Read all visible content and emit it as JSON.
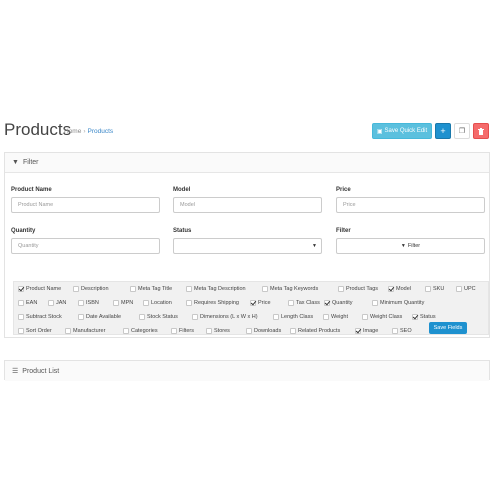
{
  "header": {
    "title": "Products",
    "breadcrumb": [
      "Home",
      "Products"
    ],
    "save_quick_edit": "Save Quick Edit",
    "add_icon": "plus-icon",
    "copy_icon": "copy-icon",
    "delete_icon": "trash-icon"
  },
  "filter": {
    "heading": "Filter",
    "product_name_label": "Product Name",
    "product_name_placeholder": "Product Name",
    "model_label": "Model",
    "model_placeholder": "Model",
    "price_label": "Price",
    "price_placeholder": "Price",
    "quantity_label": "Quantity",
    "quantity_placeholder": "Quantity",
    "status_label": "Status",
    "status_value": "",
    "filter_label": "Filter",
    "filter_button": "Filter"
  },
  "fields": {
    "items": [
      {
        "label": "Product Name",
        "checked": true
      },
      {
        "label": "Description",
        "checked": false
      },
      {
        "label": "Meta Tag Title",
        "checked": false
      },
      {
        "label": "Meta Tag Description",
        "checked": false
      },
      {
        "label": "Meta Tag Keywords",
        "checked": false
      },
      {
        "label": "Product Tags",
        "checked": false
      },
      {
        "label": "Model",
        "checked": true
      },
      {
        "label": "SKU",
        "checked": false
      },
      {
        "label": "UPC",
        "checked": false
      },
      {
        "label": "EAN",
        "checked": false
      },
      {
        "label": "JAN",
        "checked": false
      },
      {
        "label": "ISBN",
        "checked": false
      },
      {
        "label": "MPN",
        "checked": false
      },
      {
        "label": "Location",
        "checked": false
      },
      {
        "label": "Requires Shipping",
        "checked": false
      },
      {
        "label": "Price",
        "checked": true
      },
      {
        "label": "Tax Class",
        "checked": false
      },
      {
        "label": "Quantity",
        "checked": true
      },
      {
        "label": "Minimum Quantity",
        "checked": false
      },
      {
        "label": "Subtract Stock",
        "checked": false
      },
      {
        "label": "Date Available",
        "checked": false
      },
      {
        "label": "Stock Status",
        "checked": false
      },
      {
        "label": "Dimensions (L x W x H)",
        "checked": false
      },
      {
        "label": "Length Class",
        "checked": false
      },
      {
        "label": "Weight",
        "checked": false
      },
      {
        "label": "Weight Class",
        "checked": false
      },
      {
        "label": "Status",
        "checked": true
      },
      {
        "label": "Sort Order",
        "checked": false
      },
      {
        "label": "Manufacturer",
        "checked": false
      },
      {
        "label": "Categories",
        "checked": false
      },
      {
        "label": "Filters",
        "checked": false
      },
      {
        "label": "Stores",
        "checked": false
      },
      {
        "label": "Downloads",
        "checked": false
      },
      {
        "label": "Related Products",
        "checked": false
      },
      {
        "label": "Image",
        "checked": true
      },
      {
        "label": "SEO",
        "checked": false
      }
    ],
    "save_button": "Save Fields"
  },
  "product_list": {
    "heading": "Product List"
  }
}
